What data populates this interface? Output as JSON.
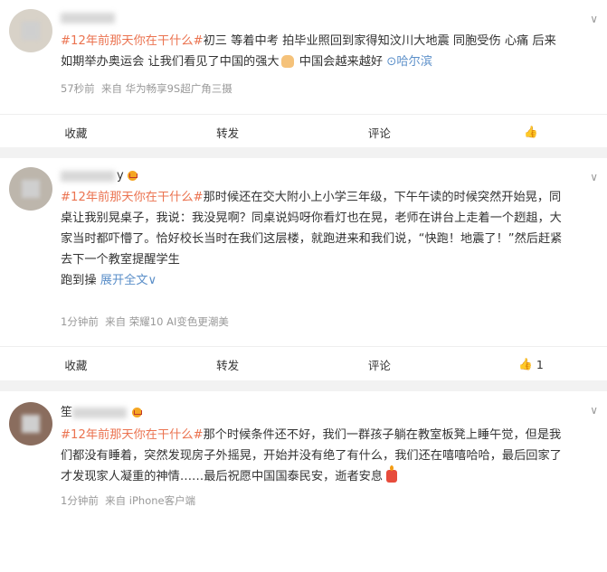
{
  "posts": [
    {
      "lines": [
        [
          "#12年前那天你在干什么#",
          "初三 等着中考 拍毕业照回到家得知汶川大地震 同胞受伤 心痛 后来"
        ],
        [
          "如期举办奥运会 让我们看见了中国的强大",
          "中国会越来越好"
        ]
      ],
      "location": "哈尔滨",
      "time": "57秒前",
      "source": "来自 华为畅享9S超广角三摄",
      "actions": {
        "fav": "收藏",
        "repost": "转发",
        "comment": "评论",
        "like": ""
      }
    },
    {
      "name_suffix": "y",
      "lines": [
        [
          "#12年前那天你在干什么#",
          "那时候还在交大附小上小学三年级，下午午读的时候突然开始晃，同"
        ],
        [
          "桌让我别晃桌子，我说：我没晃啊？同桌说妈呀你看灯也在晃，老师在讲台上走着一个趔趄，大"
        ],
        [
          "家当时都吓懵了。恰好校长当时在我们这层楼，就跑进来和我们说，“快跑！地震了！”然后赶紧"
        ],
        [
          "去下一个教室提醒学生"
        ],
        [
          "跑到操"
        ]
      ],
      "expand": "展开全文",
      "time": "1分钟前",
      "source": "来自 荣耀10 AI变色更潮美",
      "actions": {
        "fav": "收藏",
        "repost": "转发",
        "comment": "评论",
        "like": "1"
      }
    },
    {
      "name_prefix": "笙",
      "lines": [
        [
          "#12年前那天你在干什么#",
          "那个时候条件还不好，我们一群孩子躺在教室板凳上睡午觉，但是我"
        ],
        [
          "们都没有睡着，突然发现房子外摇晃，开始并没有绝了有什么，我们还在嘻嘻哈哈，最后回家了"
        ],
        [
          "才发现家人凝重的神情……最后祝愿中国国泰民安，逝者安息"
        ]
      ],
      "time": "1分钟前",
      "source": "来自 iPhone客户端"
    }
  ],
  "colors": {
    "tag": "#eb7350",
    "link": "#5b8fc9",
    "meta": "#999999"
  }
}
